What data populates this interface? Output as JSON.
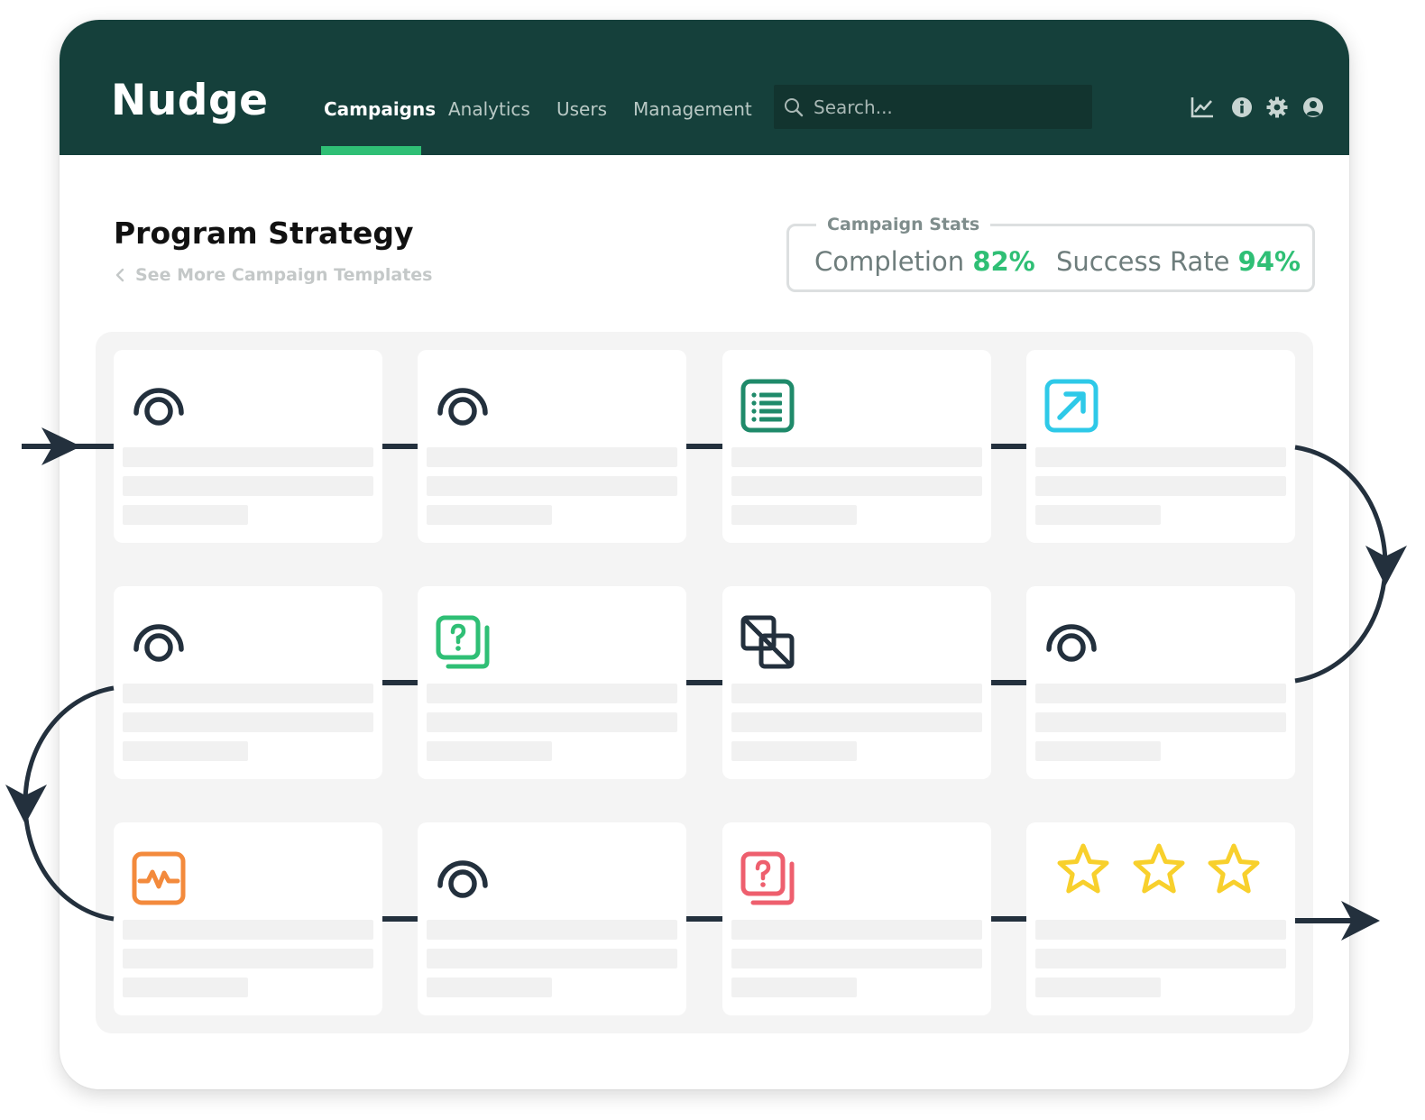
{
  "app": {
    "name": "Nudge"
  },
  "nav": {
    "tabs": [
      {
        "label": "Campaigns",
        "active": true
      },
      {
        "label": "Analytics",
        "active": false
      },
      {
        "label": "Users",
        "active": false
      },
      {
        "label": "Management",
        "active": false
      }
    ],
    "search_placeholder": "Search...",
    "icons": [
      "chart-icon",
      "info-icon",
      "gear-icon",
      "user-icon"
    ]
  },
  "page": {
    "title": "Program Strategy",
    "back_link": "See More Campaign Templates"
  },
  "stats": {
    "legend": "Campaign Stats",
    "completion_label": "Completion",
    "completion_value": "82%",
    "success_label": "Success Rate",
    "success_value": "94%"
  },
  "colors": {
    "nav_bg": "#15403b",
    "accent_green": "#2fbf75",
    "dark_icon": "#23303d",
    "teal_icon": "#1f8a6a",
    "cyan_icon": "#2ec9e8",
    "orange_icon": "#f38a3c",
    "red_icon": "#ee5f6e",
    "star_yellow": "#f8d02c"
  },
  "cards": [
    {
      "icon": "ring-icon"
    },
    {
      "icon": "ring-icon"
    },
    {
      "icon": "list-icon"
    },
    {
      "icon": "external-link-icon"
    },
    {
      "icon": "ring-icon"
    },
    {
      "icon": "question-cards-icon"
    },
    {
      "icon": "overlap-squares-icon"
    },
    {
      "icon": "ring-icon"
    },
    {
      "icon": "activity-icon"
    },
    {
      "icon": "ring-icon"
    },
    {
      "icon": "question-cards-icon"
    },
    {
      "icon": "rating-stars-icon",
      "rating": 3
    }
  ]
}
